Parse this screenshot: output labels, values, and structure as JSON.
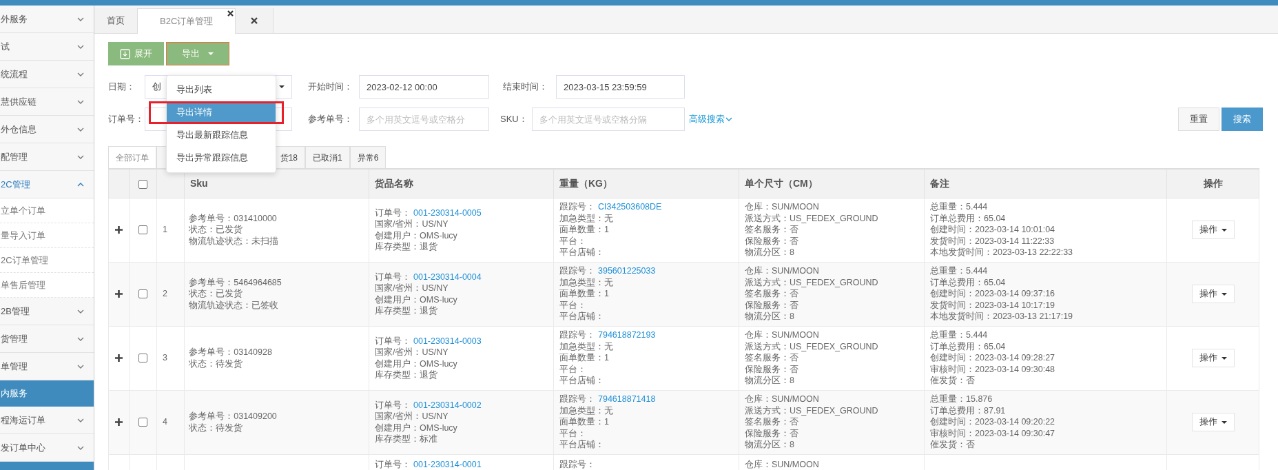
{
  "sidebar": {
    "items": [
      {
        "kind": "group",
        "label": "外服务",
        "expanded": false
      },
      {
        "kind": "group",
        "label": "试",
        "expanded": false
      },
      {
        "kind": "group",
        "label": "统流程",
        "expanded": false
      },
      {
        "kind": "group",
        "label": "慧供应链",
        "expanded": false
      },
      {
        "kind": "group",
        "label": "外仓信息",
        "expanded": false
      },
      {
        "kind": "group",
        "label": "配管理",
        "expanded": false
      },
      {
        "kind": "group",
        "label": "2C管理",
        "expanded": true,
        "children": [
          {
            "label": "立单个订单"
          },
          {
            "label": "量导入订单"
          },
          {
            "label": "2C订单管理"
          },
          {
            "label": "单售后管理"
          }
        ]
      },
      {
        "kind": "group",
        "label": "2B管理",
        "expanded": false
      },
      {
        "kind": "group",
        "label": "货管理",
        "expanded": false
      },
      {
        "kind": "group",
        "label": "单管理",
        "expanded": false
      },
      {
        "kind": "section",
        "label": "内服务"
      },
      {
        "kind": "group",
        "label": "程海运订单",
        "expanded": false
      },
      {
        "kind": "group",
        "label": "发订单中心",
        "expanded": false
      }
    ]
  },
  "tabs": [
    {
      "label": "首页",
      "selected": false,
      "closable": false
    },
    {
      "label": "B2C订单管理",
      "selected": true,
      "closable": true
    },
    {
      "selected": false,
      "closable": true
    }
  ],
  "toolbar": {
    "expand_button": "展开",
    "export_button": "导出",
    "export_menu": [
      {
        "label": "导出列表",
        "selected": false,
        "annotated": false
      },
      {
        "label": "导出详情",
        "selected": true,
        "annotated": true
      },
      {
        "label": "导出最新跟踪信息",
        "selected": false,
        "annotated": false
      },
      {
        "label": "导出异常跟踪信息",
        "selected": false,
        "annotated": false
      }
    ]
  },
  "filters": {
    "date_label": "日期：",
    "date_type": "创",
    "start_label": "开始时间：",
    "start_value": "2023-02-12 00:00",
    "end_label": "结束时间：",
    "end_value": "2023-03-15 23:59:59",
    "order_label": "订单号：",
    "ref_label": "参考单号：",
    "ref_placeholder": "多个用英文逗号或空格分",
    "sku_label": "SKU：",
    "sku_placeholder": "多个用英文逗号或空格分隔",
    "advanced": "高级搜索",
    "reset_button": "重置",
    "search_button": "搜索"
  },
  "status_tabs": [
    {
      "label": "全部订单",
      "selected": true
    },
    {
      "label": "货18",
      "selected": false
    },
    {
      "label": "已取消1",
      "selected": false
    },
    {
      "label": "异常6",
      "selected": false
    }
  ],
  "table": {
    "select_all": {
      "checked": false
    },
    "columns": [
      "Sku",
      "货品名称",
      "重量（KG）",
      "单个尺寸（CM）",
      "备注",
      "操作"
    ],
    "rows": [
      {
        "index": "1",
        "checked": false,
        "sku": [
          "参考单号：031410000",
          "状态：已发货",
          "物流轨迹状态：未扫描"
        ],
        "goods": [
          {
            "label": "订单号：",
            "link": "001-230314-0005"
          },
          "国家/省州：US/NY",
          "创建用户：OMS-lucy",
          "库存类型：退货"
        ],
        "weight": [
          {
            "label": "跟踪号：",
            "link": "CI342503608DE"
          },
          "加急类型：无",
          "面单数量：1",
          "平台：",
          "平台店铺："
        ],
        "size": [
          "仓库：SUN/MOON",
          "派送方式：US_FEDEX_GROUND",
          "签名服务：否",
          "保险服务：否",
          "物流分区：8"
        ],
        "remarks": [
          "总重量：5.444",
          "订单总费用：65.04",
          "创建时间：2023-03-14 10:01:04",
          "发货时间：2023-03-14 11:22:33",
          "本地发货时间：2023-03-13 22:22:33"
        ],
        "action": "操作"
      },
      {
        "index": "2",
        "checked": false,
        "sku": [
          "参考单号：5464964685",
          "状态：已发货",
          "物流轨迹状态：已签收"
        ],
        "goods": [
          {
            "label": "订单号：",
            "link": "001-230314-0004"
          },
          "国家/省州：US/NY",
          "创建用户：OMS-lucy",
          "库存类型：退货"
        ],
        "weight": [
          {
            "label": "跟踪号：",
            "link": "395601225033"
          },
          "加急类型：无",
          "面单数量：1",
          "平台：",
          "平台店铺："
        ],
        "size": [
          "仓库：SUN/MOON",
          "派送方式：US_FEDEX_GROUND",
          "签名服务：否",
          "保险服务：否",
          "物流分区：8"
        ],
        "remarks": [
          "总重量：5.444",
          "订单总费用：65.04",
          "创建时间：2023-03-14 09:37:16",
          "发货时间：2023-03-14 10:17:19",
          "本地发货时间：2023-03-13 21:17:19"
        ],
        "action": "操作"
      },
      {
        "index": "3",
        "checked": false,
        "sku": [
          "参考单号：03140928",
          "状态：待发货"
        ],
        "goods": [
          {
            "label": "订单号：",
            "link": "001-230314-0003"
          },
          "国家/省州：US/NY",
          "创建用户：OMS-lucy",
          "库存类型：退货"
        ],
        "weight": [
          {
            "label": "跟踪号：",
            "link": "794618872193"
          },
          "加急类型：无",
          "面单数量：1",
          "平台：",
          "平台店铺："
        ],
        "size": [
          "仓库：SUN/MOON",
          "派送方式：US_FEDEX_GROUND",
          "签名服务：否",
          "保险服务：否",
          "物流分区：8"
        ],
        "remarks": [
          "总重量：5.444",
          "订单总费用：65.04",
          "创建时间：2023-03-14 09:28:27",
          "审核时间：2023-03-14 09:30:48",
          "催发货：否"
        ],
        "action": "操作"
      },
      {
        "index": "4",
        "checked": false,
        "sku": [
          "参考单号：031409200",
          "状态：待发货"
        ],
        "goods": [
          {
            "label": "订单号：",
            "link": "001-230314-0002"
          },
          "国家/省州：US/NY",
          "创建用户：OMS-lucy",
          "库存类型：标准"
        ],
        "weight": [
          {
            "label": "跟踪号：",
            "link": "794618871418"
          },
          "加急类型：无",
          "面单数量：1",
          "平台：",
          "平台店铺："
        ],
        "size": [
          "仓库：SUN/MOON",
          "派送方式：US_FEDEX_GROUND",
          "签名服务：否",
          "保险服务：否",
          "物流分区：8"
        ],
        "remarks": [
          "总重量：15.876",
          "订单总费用：87.91",
          "创建时间：2023-03-14 09:20:22",
          "审核时间：2023-03-14 09:30:47",
          "催发货：否"
        ],
        "action": "操作"
      },
      {
        "goods": [
          {
            "label": "订单号：",
            "link": "001-230314-0001"
          }
        ],
        "weight": [
          "跟踪号："
        ],
        "size": [
          "仓库：SUN/MOON"
        ]
      }
    ]
  }
}
